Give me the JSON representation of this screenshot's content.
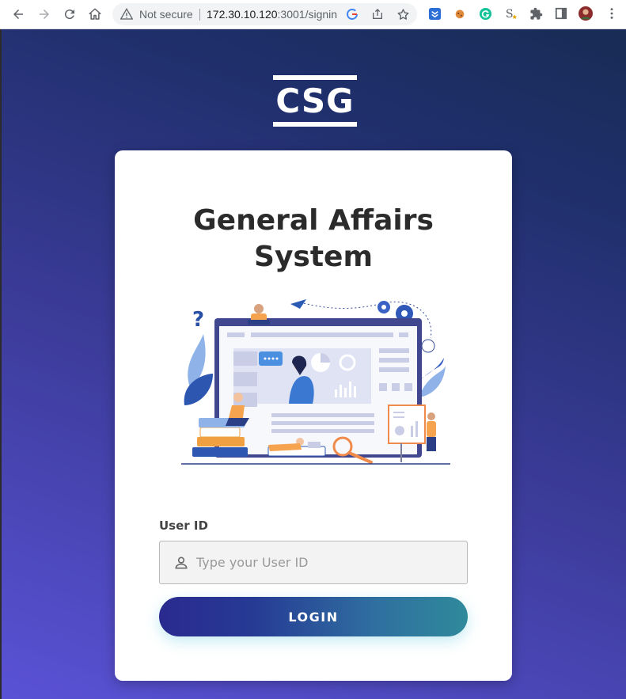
{
  "browser": {
    "security_label": "Not secure",
    "url_host": "172.30.10.120",
    "url_rest": ":3001/signin"
  },
  "brand": {
    "logo_text": "CSG",
    "logo_color": "#ffffff"
  },
  "login": {
    "title_line1": "General Affairs",
    "title_line2": "System",
    "user_id_label": "User ID",
    "user_id_placeholder": "Type your User ID",
    "user_id_value": "",
    "login_button": "LOGIN"
  },
  "colors": {
    "background_gradient": [
      "#5a52d6",
      "#182c55"
    ],
    "button_gradient": [
      "#2a2a8f",
      "#2f8a9b"
    ],
    "title": "#2b2b2b"
  },
  "icons": {
    "back": "arrow-left-icon",
    "forward": "arrow-right-icon",
    "reload": "reload-icon",
    "home": "home-icon",
    "warning": "warning-triangle-icon",
    "user": "user-icon"
  }
}
